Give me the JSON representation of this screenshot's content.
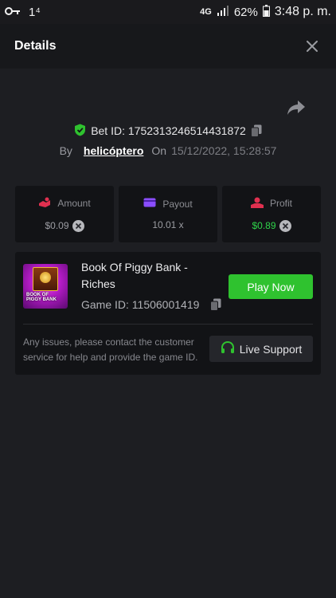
{
  "status_bar": {
    "left_text": "1⁴",
    "network": "4G",
    "battery": "62%",
    "time": "3:48 p. m."
  },
  "header": {
    "title": "Details"
  },
  "bet": {
    "id_label": "Bet ID: 1752313246514431872",
    "by_label": "By",
    "user": "helicóptero",
    "on_label": "On",
    "date": "15/12/2022, 15:28:57"
  },
  "stats": {
    "amount": {
      "label": "Amount",
      "value": "$0.09"
    },
    "payout": {
      "label": "Payout",
      "value": "10.01 x"
    },
    "profit": {
      "label": "Profit",
      "value": "$0.89"
    }
  },
  "game": {
    "name": "Book Of Piggy Bank - Riches",
    "id_label": "Game ID: 11506001419",
    "thumb_line1": "BOOK OF",
    "thumb_line2": "PIGGY BANK",
    "play_label": "Play Now"
  },
  "support": {
    "note": "Any issues, please contact the customer service for help and provide the game ID.",
    "button_label": "Live Support"
  },
  "colors": {
    "background": "#1d1e22",
    "accent_green": "#2fc22f",
    "profit_green": "#2fd44a",
    "amount_icon": "#e0304f",
    "payout_icon": "#8a4dff"
  },
  "icons": [
    "key-icon",
    "signal-icon",
    "battery-icon",
    "close-icon",
    "share-icon",
    "shield-icon",
    "copy-icon",
    "coins-icon",
    "card-icon",
    "hand-coin-icon",
    "headset-icon"
  ]
}
